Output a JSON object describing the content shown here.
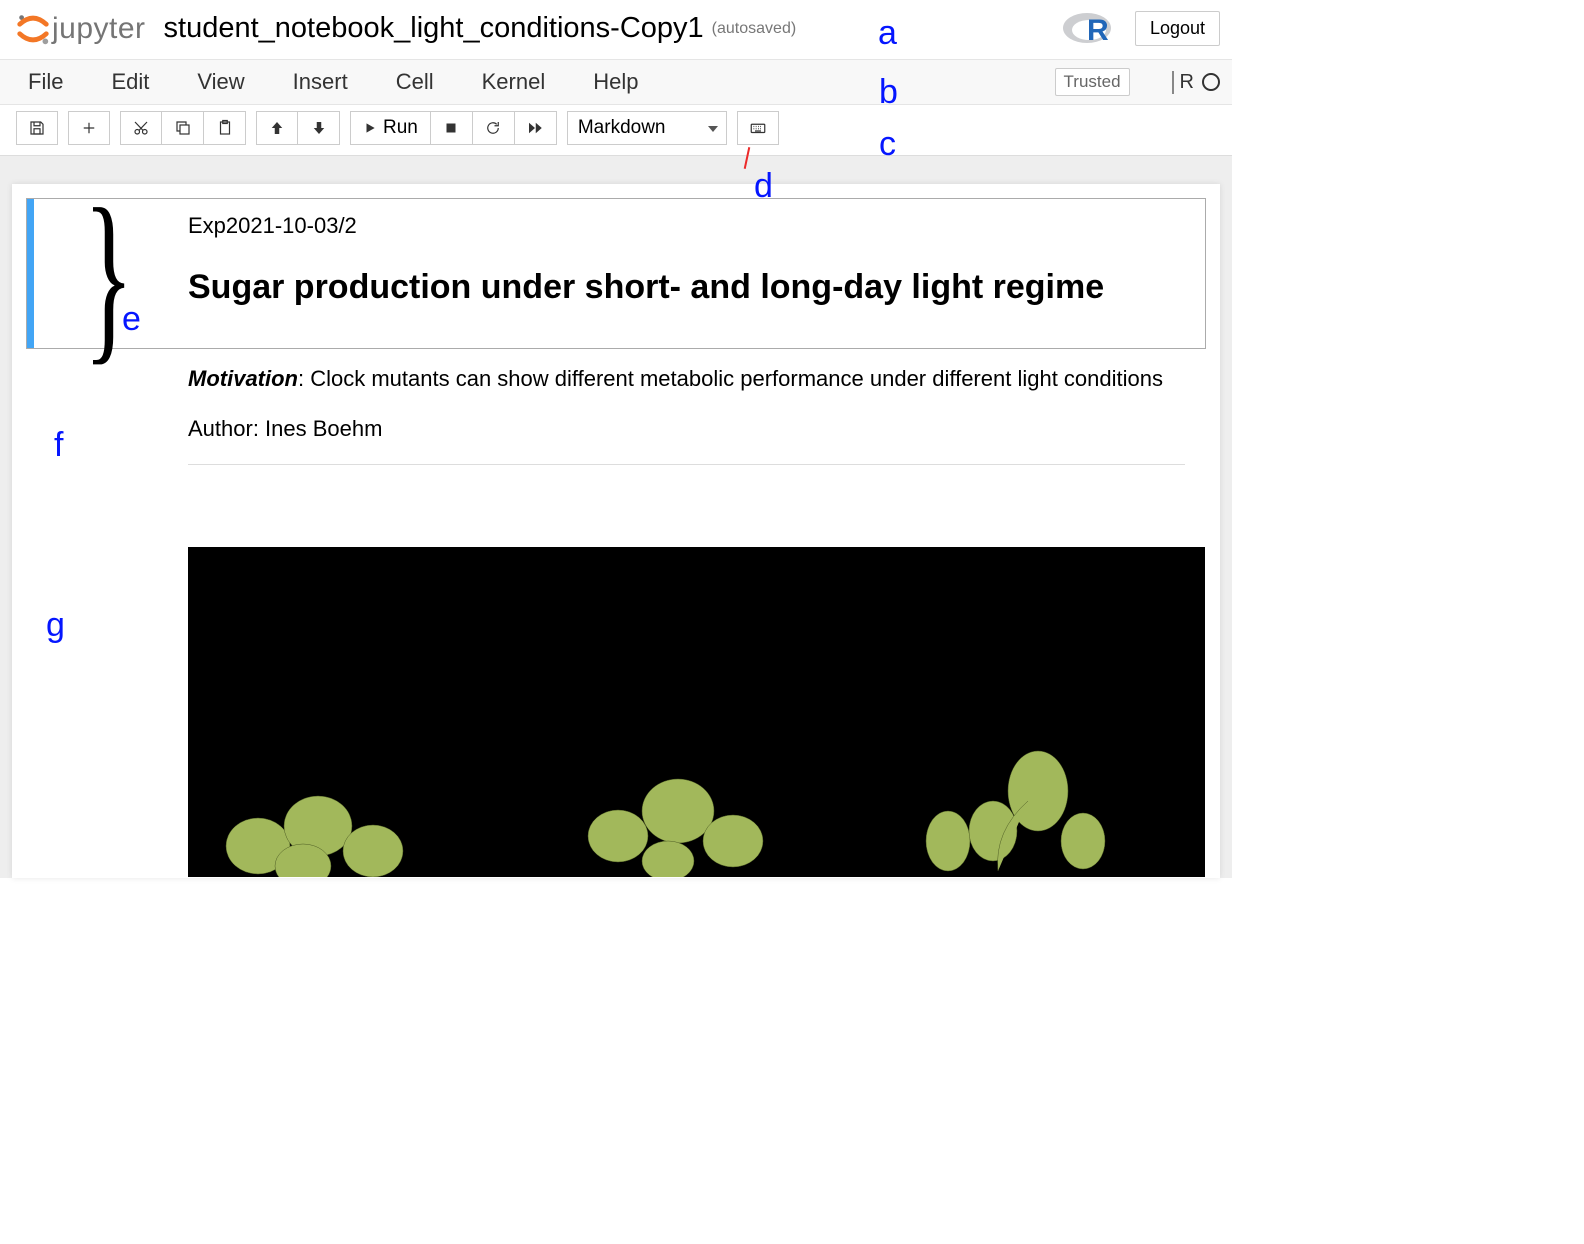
{
  "header": {
    "logo_text": "jupyter",
    "notebook_name": "student_notebook_light_conditions-Copy1",
    "autosaved": "(autosaved)",
    "logout": "Logout"
  },
  "menubar": {
    "items": [
      "File",
      "Edit",
      "View",
      "Insert",
      "Cell",
      "Kernel",
      "Help"
    ],
    "trusted": "Trusted",
    "kernel_name": "R"
  },
  "toolbar": {
    "run_label": "Run",
    "celltype_value": "Markdown"
  },
  "annotations": {
    "a": "a",
    "b": "b",
    "c": "c",
    "d": "d",
    "e": "e",
    "f": "f",
    "g": "g"
  },
  "cells": {
    "c1": {
      "exp_id": "Exp2021-10-03/2",
      "title": "Sugar production under short- and long-day light regime"
    },
    "c2": {
      "motivation_label": "Motivation",
      "motivation_text": ": Clock mutants can show different metabolic performance under different light conditions",
      "author": "Author: Ines Boehm"
    }
  }
}
